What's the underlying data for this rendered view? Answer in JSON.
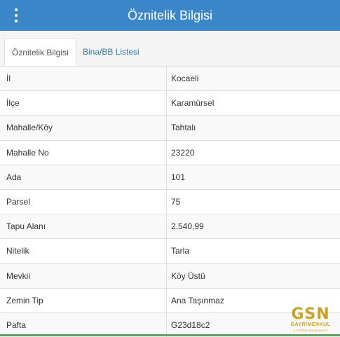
{
  "header": {
    "title": "Öznitelik Bilgisi",
    "menu_icon": "more-vertical-icon"
  },
  "tabs": [
    {
      "label": "Öznitelik Bilgisi",
      "active": true
    },
    {
      "label": "Bina/BB Listesi",
      "active": false
    }
  ],
  "rows": [
    {
      "label": "İl",
      "value": "Kocaeli"
    },
    {
      "label": "İlçe",
      "value": "Karamürsel"
    },
    {
      "label": "Mahalle/Köy",
      "value": "Tahtalı"
    },
    {
      "label": "Mahalle No",
      "value": "23220"
    },
    {
      "label": "Ada",
      "value": "101"
    },
    {
      "label": "Parsel",
      "value": "75"
    },
    {
      "label": "Tapu Alanı",
      "value": "2.540,99"
    },
    {
      "label": "Nitelik",
      "value": "Tarla"
    },
    {
      "label": "Mevkii",
      "value": "Köy Üstü"
    },
    {
      "label": "Zemin Tip",
      "value": "Ana Taşınmaz"
    },
    {
      "label": "Pafta",
      "value": "G23d18c2"
    }
  ],
  "logo": {
    "main": "GSN",
    "sub": "GAYRİMENKUL",
    "sub2": "& YATIRIM DANIŞMANLIĞI"
  },
  "colors": {
    "header_bg": "#3a86c9",
    "tab_link": "#337ab7",
    "logo_gold": "#c9a227"
  }
}
